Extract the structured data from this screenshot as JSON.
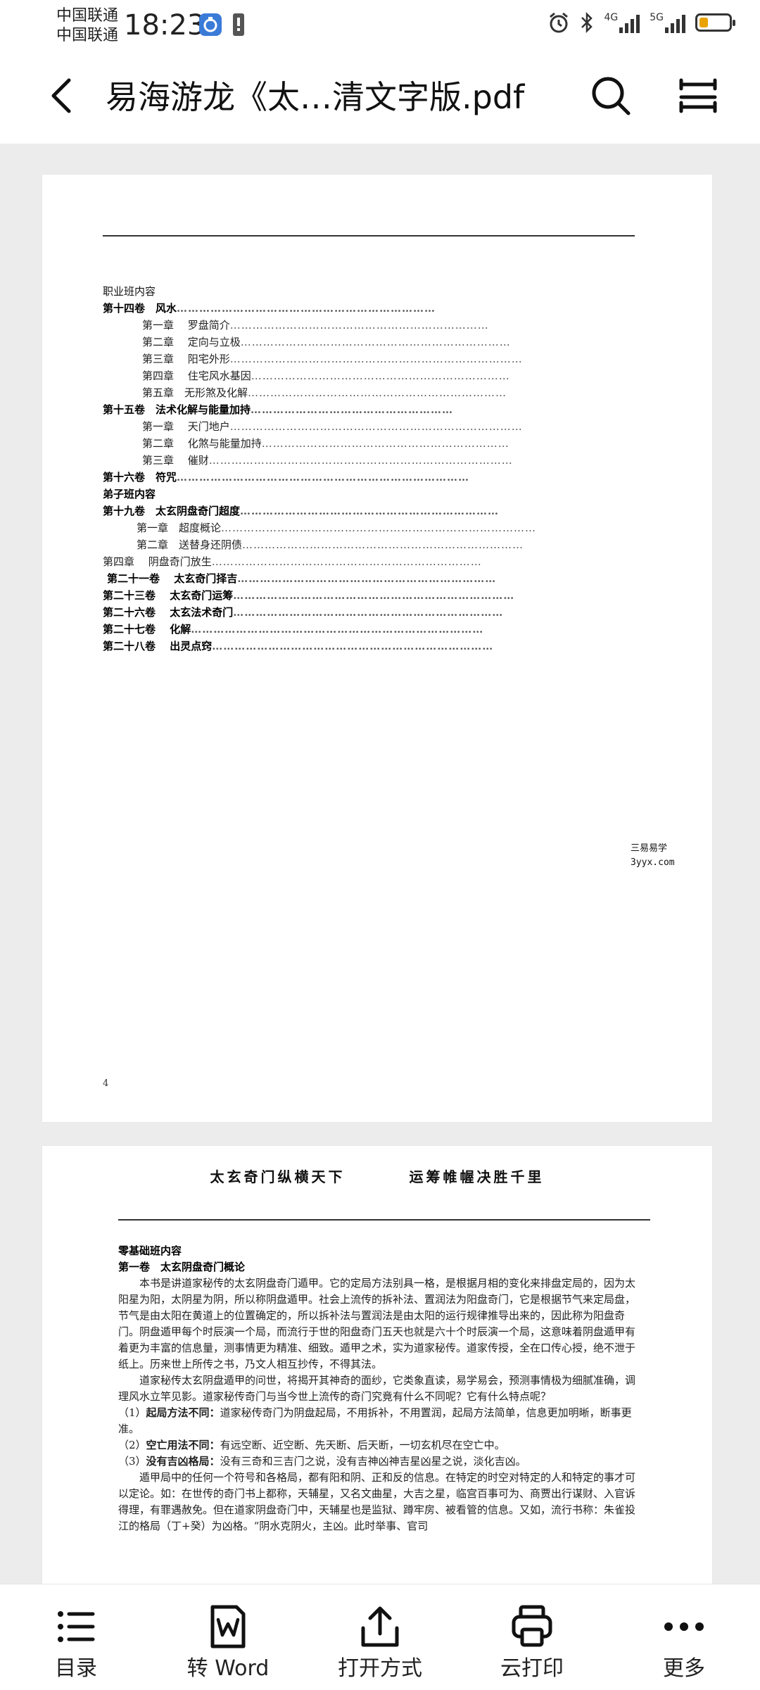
{
  "status_bar": {
    "carrier1": "中国联通",
    "carrier2": "中国联通",
    "time": "18:23",
    "net1": "4G",
    "net2": "5G"
  },
  "app_bar": {
    "title": "易海游龙《太…清文字版.pdf"
  },
  "page1": {
    "toc_heading": "职业班内容",
    "toc": [
      {
        "label": "第十四卷　风水",
        "dots": "……………………………………………………………",
        "bold": true,
        "indent": 0
      },
      {
        "label": "第一章　 罗盘简介",
        "dots": "……………………………………………………………",
        "bold": false,
        "indent": 56
      },
      {
        "label": "第二章　 定向与立极",
        "dots": "………………………………………………………………",
        "bold": false,
        "indent": 56
      },
      {
        "label": "第三章　 阳宅外形",
        "dots": "……………………………………………………………………",
        "bold": false,
        "indent": 56
      },
      {
        "label": "第四章　 住宅风水基因",
        "dots": "……………………………………………………………",
        "bold": false,
        "indent": 56
      },
      {
        "label": "第五章　无形煞及化解",
        "dots": "……………………………………………………………",
        "bold": false,
        "indent": 56
      },
      {
        "label": "第十五卷　法术化解与能量加持",
        "dots": "………………………………………………",
        "bold": true,
        "indent": 0
      },
      {
        "label": "第一章　 天门地户",
        "dots": "……………………………………………………………………",
        "bold": false,
        "indent": 56
      },
      {
        "label": "第二章　 化煞与能量加持",
        "dots": "…………………………………………………………",
        "bold": false,
        "indent": 56
      },
      {
        "label": "第三章　 催财",
        "dots": "………………………………………………………………………",
        "bold": false,
        "indent": 56
      },
      {
        "label": "第十六卷　符咒",
        "dots": "……………………………………………………………………",
        "bold": true,
        "indent": 0
      },
      {
        "label": "弟子班内容",
        "dots": "",
        "bold": true,
        "indent": 0
      },
      {
        "label": "第十九卷　太玄阴盘奇门超度",
        "dots": "……………………………………………………………",
        "bold": true,
        "indent": 0
      },
      {
        "label": "第一章　超度概论",
        "dots": "…………………………………………………………………………",
        "bold": false,
        "indent": 48
      },
      {
        "label": "第二章　送替身还阴债",
        "dots": "…………………………………………………………………",
        "bold": false,
        "indent": 48
      },
      {
        "label": "第四章　 阴盘奇门放生",
        "dots": "………………………………………………………………",
        "bold": false,
        "indent": 0
      },
      {
        "label": "第二十一卷　 太玄奇门择吉",
        "dots": "……………………………………………………………",
        "bold": true,
        "indent": 6
      },
      {
        "label": "第二十三卷　 太玄奇门运筹",
        "dots": "…………………………………………………………………",
        "bold": true,
        "indent": 0
      },
      {
        "label": "第二十六卷　 太玄法术奇门",
        "dots": "………………………………………………………………",
        "bold": true,
        "indent": 0
      },
      {
        "label": "第二十七卷　 化解",
        "dots": "……………………………………………………………………",
        "bold": true,
        "indent": 0
      },
      {
        "label": "第二十八卷　 出灵点窍",
        "dots": "…………………………………………………………………",
        "bold": true,
        "indent": 0
      }
    ],
    "watermark_line1": "三易易学",
    "watermark_line2": "3yyx.com",
    "page_number": "4"
  },
  "page2": {
    "header_left": "太玄奇门纵横天下",
    "header_right": "运筹帷幄决胜千里",
    "section_heading": "零基础班内容",
    "chapter_heading": "第一卷　太玄阴盘奇门概论",
    "para1": "本书是讲道家秘传的太玄阴盘奇门遁甲。它的定局方法别具一格，是根据月相的变化来排盘定局的，因为太阳星为阳，太阴星为阴，所以称阴盘遁甲。社会上流传的拆补法、置润法为阳盘奇门，它是根据节气来定局盘，节气是由太阳在黄道上的位置确定的，所以拆补法与置润法是由太阳的运行规律推导出来的，因此称为阳盘奇门。阴盘遁甲每个时辰演一个局，而流行于世的阳盘奇门五天也就是六十个时辰演一个局，这意味着阴盘遁甲有着更为丰富的信息量，测事情更为精准、细致。遁甲之术，实为道家秘传。道家传授，全在口传心授，绝不泄于纸上。历来世上所传之书，乃文人相互抄传，不得其法。",
    "para2": "道家秘传太玄阴盘遁甲的问世，将揭开其神奇的面纱，它类象直读，易学易会，预测事情极为细腻准确，调理风水立竿见影。道家秘传奇门与当今世上流传的奇门究竟有什么不同呢？它有什么特点呢？",
    "item1_num": "（1）",
    "item1_label": "起局方法不同：",
    "item1_text": "道家秘传奇门为阴盘起局，不用拆补，不用置润，起局方法简单，信息更加明晰，断事更准。",
    "item2_num": "（2）",
    "item2_label": "空亡用法不同：",
    "item2_text": "有远空断、近空断、先天断、后天断，一切玄机尽在空亡中。",
    "item3_num": "（3）",
    "item3_label": "没有吉凶格局：",
    "item3_text": "没有三奇和三吉门之说，没有吉神凶神吉星凶星之说，淡化吉凶。",
    "para3": "遁甲局中的任何一个符号和各格局，都有阳和阴、正和反的信息。在特定的时空对特定的人和特定的事才可以定论。如：在世传的奇门书上都称，天辅星，又名文曲星，大吉之星，临宫百事可为、商贾出行谋财、入官诉得理，有罪遇赦免。但在道家阴盘奇门中，天辅星也是监狱、蹲牢房、被看管的信息。又如，流行书称：朱雀投江的格局（丁+癸）为凶格。“阴水克阴火，主凶。此时举事、官司"
  },
  "bottom_bar": {
    "toc": "目录",
    "to_word": "转 Word",
    "open_with": "打开方式",
    "cloud_print": "云打印",
    "more": "更多"
  },
  "colors": {
    "accent_battery": "#e9a200",
    "background": "#ececec",
    "page": "#ffffff"
  },
  "icons": [
    "back-arrow-icon",
    "search-icon",
    "menu-icon",
    "list-icon",
    "word-icon",
    "share-icon",
    "printer-icon",
    "more-dots-icon",
    "alarm-icon",
    "bluetooth-icon",
    "signal-icon",
    "battery-icon"
  ]
}
